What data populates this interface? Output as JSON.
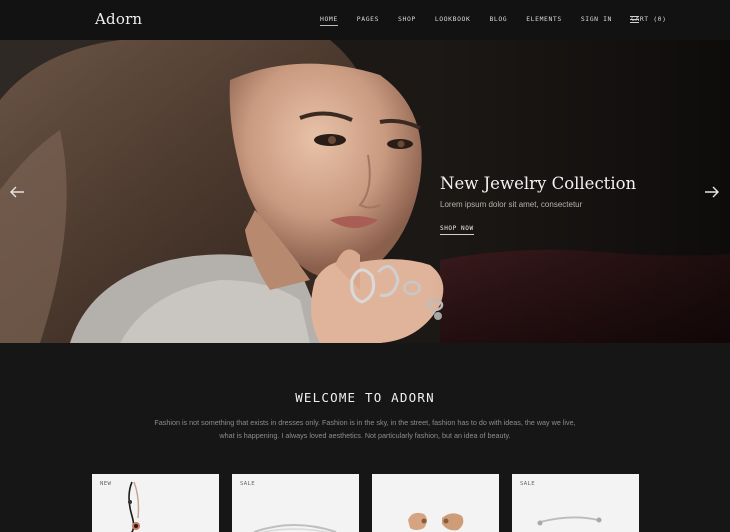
{
  "header": {
    "logo": "Adorn",
    "nav": [
      {
        "label": "HOME",
        "active": true
      },
      {
        "label": "PAGES"
      },
      {
        "label": "SHOP"
      },
      {
        "label": "LOOKBOOK"
      },
      {
        "label": "BLOG"
      },
      {
        "label": "ELEMENTS"
      },
      {
        "label": "SIGN IN"
      },
      {
        "label": "CART (0)"
      }
    ],
    "menu_icon": "hamburger-menu-icon"
  },
  "hero": {
    "title": "New Jewelry Collection",
    "subtitle": "Lorem ipsum dolor sit amet, consectetur",
    "cta": "SHOP NOW",
    "prev_icon": "arrow-left-icon",
    "next_icon": "arrow-right-icon"
  },
  "welcome": {
    "title": "WELCOME TO ADORN",
    "text": "Fashion is not something that exists in dresses only. Fashion is in the sky, in the street, fashion has to do with ideas, the way we live, what is happening. I always loved aesthetics. Not particularly fashion, but an idea of beauty."
  },
  "products": [
    {
      "badge": "NEW",
      "icon": "necklace-icon"
    },
    {
      "badge": "SALE",
      "icon": "bracelet-icon"
    },
    {
      "badge": "",
      "icon": "gold-earrings-icon"
    },
    {
      "badge": "SALE",
      "icon": "bangle-icon"
    }
  ],
  "colors": {
    "background": "#161616",
    "header": "#121212",
    "card": "#f3f3f3",
    "text_muted": "#8d8d8d"
  }
}
